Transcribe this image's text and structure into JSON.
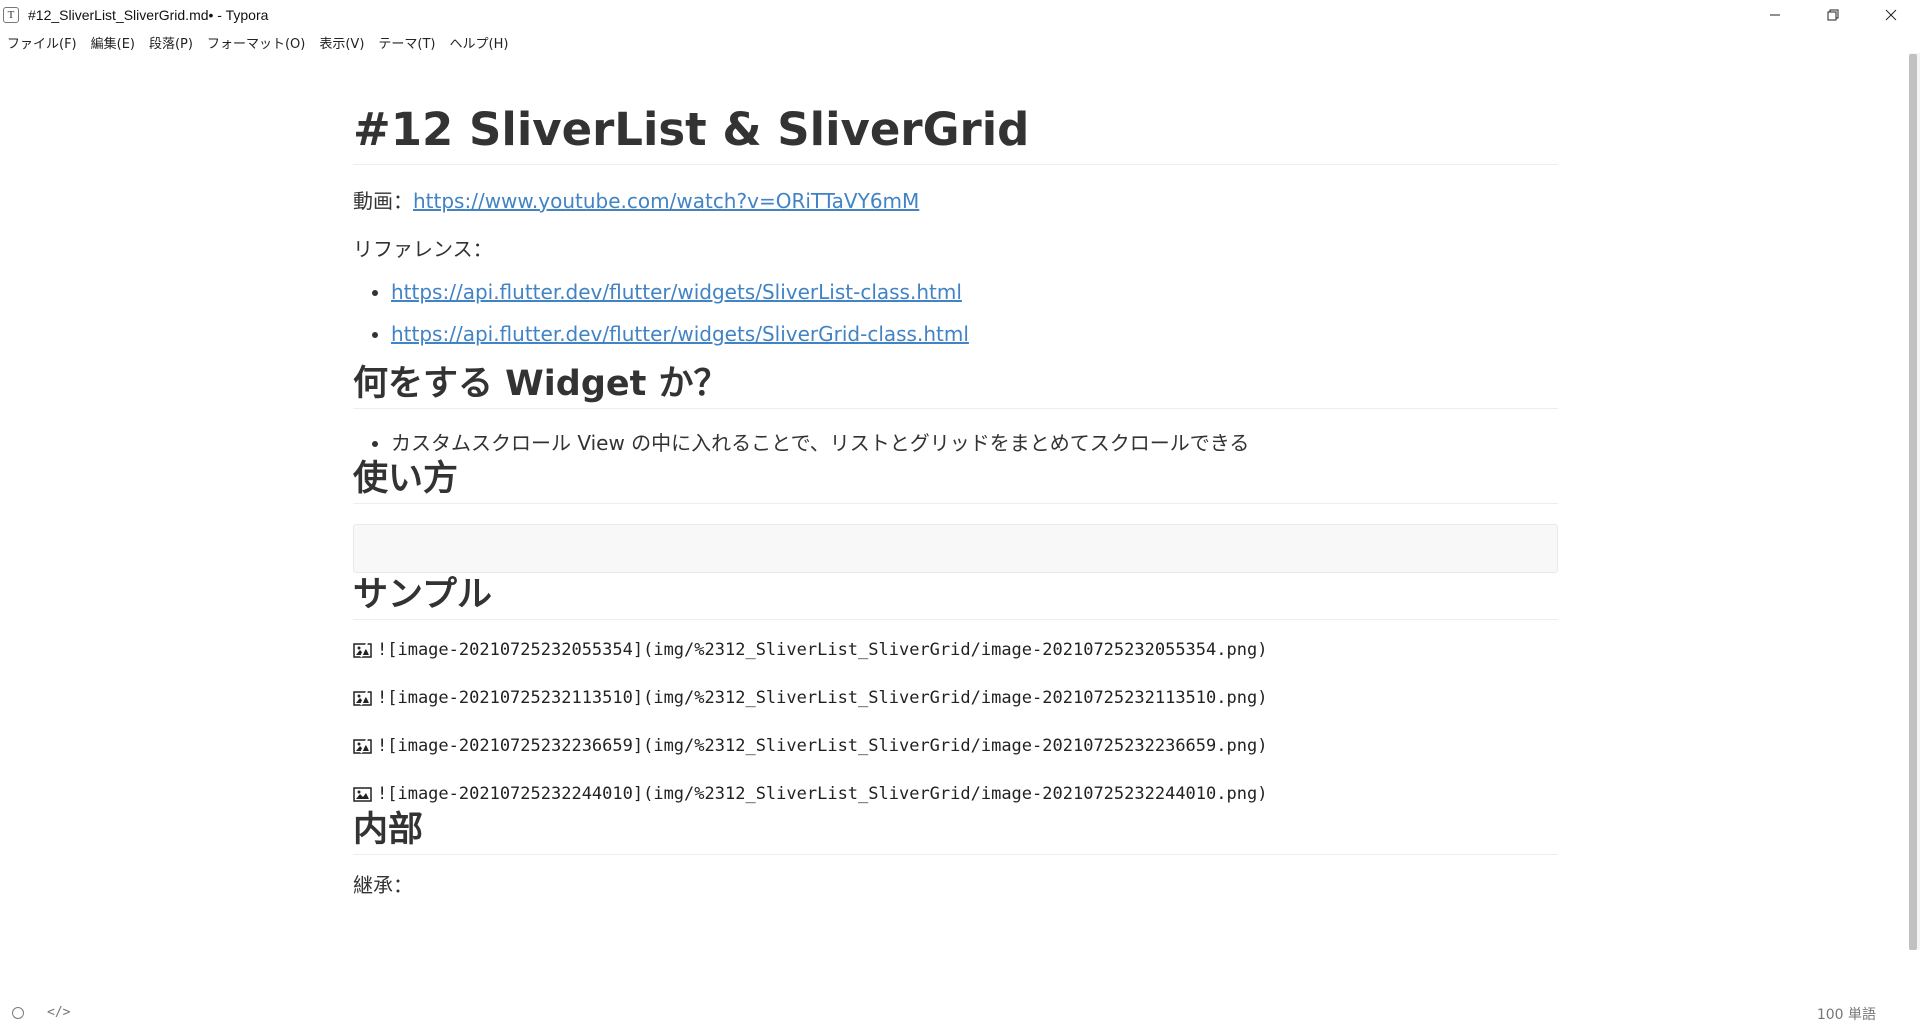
{
  "window": {
    "app_icon_letter": "T",
    "title": "#12_SliverList_SliverGrid.md• - Typora"
  },
  "menu": [
    "ファイル(F)",
    "編集(E)",
    "段落(P)",
    "フォーマット(O)",
    "表示(V)",
    "テーマ(T)",
    "ヘルプ(H)"
  ],
  "document": {
    "title": "#12 SliverList & SliverGrid",
    "video_label": "動画：",
    "video_url": "https://www.youtube.com/watch?v=ORiTTaVY6mM",
    "reference_label": "リファレンス：",
    "reference_links": [
      "https://api.flutter.dev/flutter/widgets/SliverList-class.html",
      "https://api.flutter.dev/flutter/widgets/SliverGrid-class.html"
    ],
    "heading_what": "何をする Widget か？",
    "what_bullets": [
      "カスタムスクロール View の中に入れることで、リストとグリッドをまとめてスクロールできる"
    ],
    "heading_usage": "使い方",
    "heading_sample": "サンプル",
    "image_refs": [
      {
        "text": "![image-20210725232055354](img/%2312_SliverList_SliverGrid/image-20210725232055354.png)",
        "icon": "broken-image-icon"
      },
      {
        "text": "![image-20210725232113510](img/%2312_SliverList_SliverGrid/image-20210725232113510.png)",
        "icon": "broken-image-icon"
      },
      {
        "text": "![image-20210725232236659](img/%2312_SliverList_SliverGrid/image-20210725232236659.png)",
        "icon": "broken-image-icon"
      },
      {
        "text": "![image-20210725232244010](img/%2312_SliverList_SliverGrid/image-20210725232244010.png)",
        "icon": "image-icon"
      }
    ],
    "heading_inner": "内部",
    "inherit_label": "継承："
  },
  "statusbar": {
    "word_count": "100 単語"
  },
  "colors": {
    "link": "#4183c4",
    "text": "#333333",
    "code_bg": "#f8f8f8"
  }
}
